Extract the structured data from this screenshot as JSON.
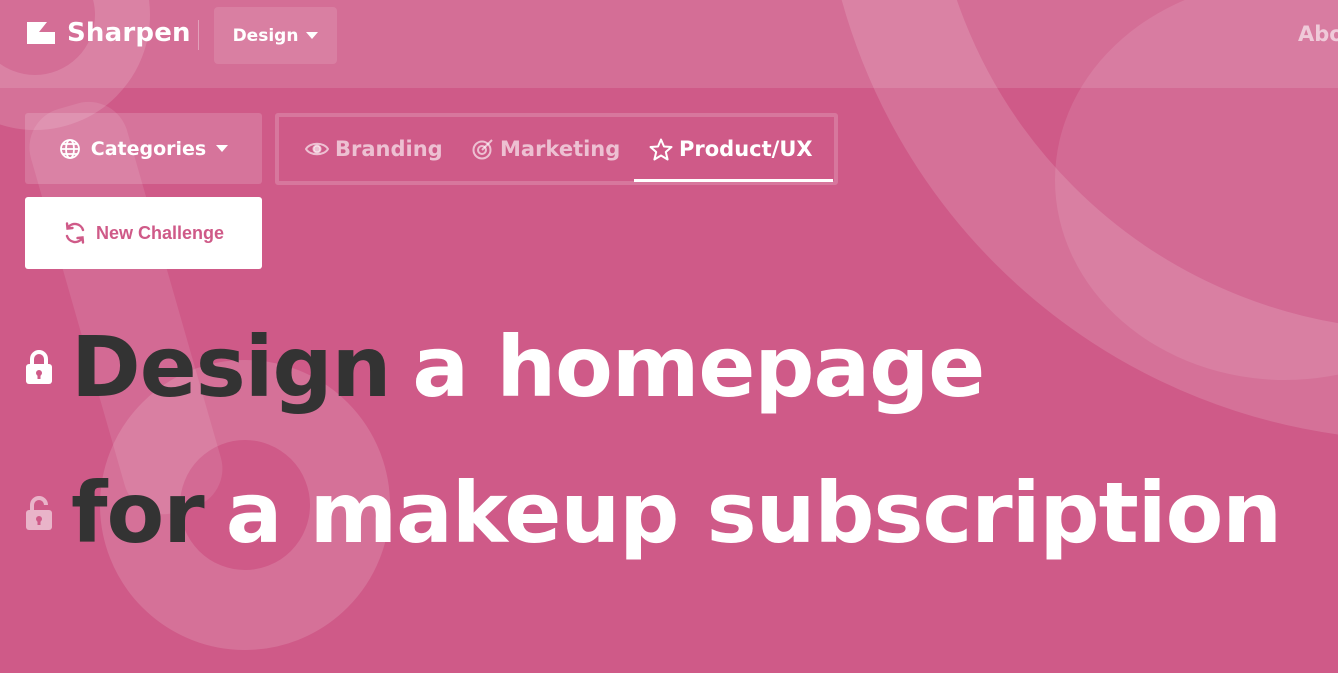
{
  "nav": {
    "brand": "Sharpen",
    "domain_dropdown": "Design",
    "about_partial": "Abo"
  },
  "controls": {
    "categories_label": "Categories",
    "tabs": [
      {
        "label": "Branding",
        "icon": "eye-icon",
        "active": false
      },
      {
        "label": "Marketing",
        "icon": "target-icon",
        "active": false
      },
      {
        "label": "Product/UX",
        "icon": "star-icon",
        "active": true
      }
    ],
    "new_challenge_label": "New Challenge"
  },
  "challenge": {
    "line1": {
      "locked_word": "Design",
      "text": "a homepage",
      "lock_state": "locked"
    },
    "line2": {
      "locked_word": "for",
      "text": "a makeup subscription",
      "lock_state": "unlocked"
    }
  },
  "colors": {
    "background": "#cf5a88",
    "dark_text": "#333333",
    "accent": "#cf5a88"
  }
}
